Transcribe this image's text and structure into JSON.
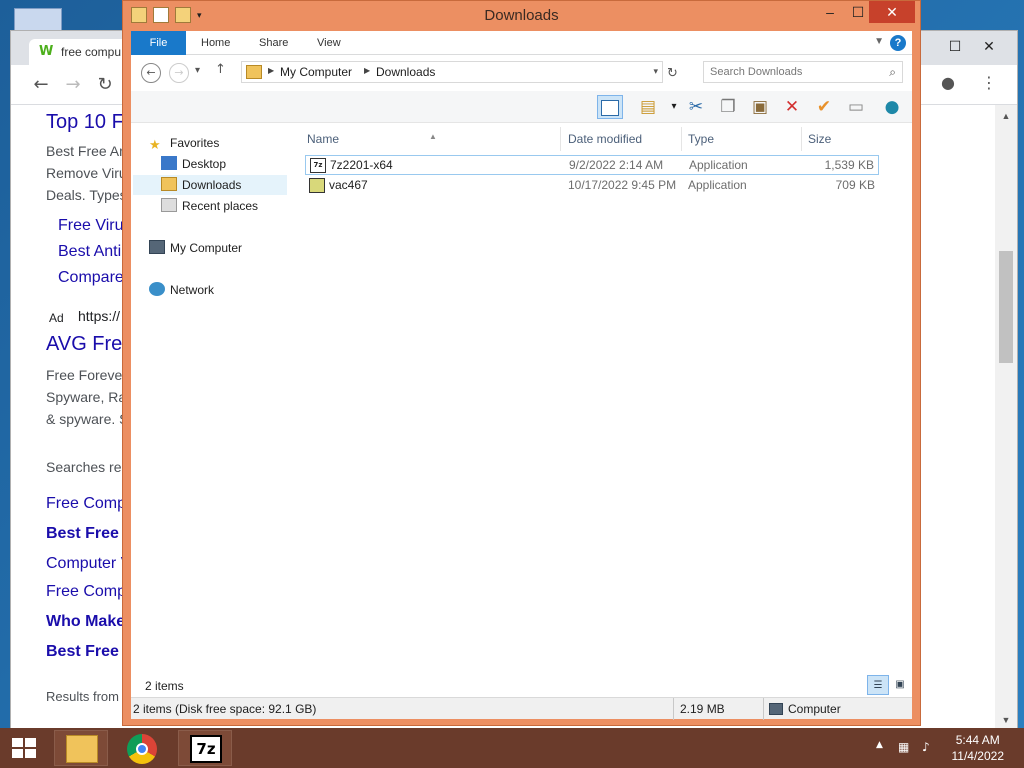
{
  "browser": {
    "tab_title": "free compu",
    "tab_icon_letter": "W",
    "results": {
      "title1": "Top 10 F",
      "text1": "Best Free An",
      "text2": "Remove Viru",
      "text3": "Deals. Types",
      "sub_links": [
        "Free Virus",
        "Best Anti",
        "Compare"
      ],
      "ad_label": "Ad",
      "ad_url": "https://",
      "title2": "AVG Free",
      "text4": "Free Forever",
      "text5": "Spyware, Ra",
      "text6": "& spyware. S",
      "searches_related": "Searches rel",
      "related": [
        "Free Comp",
        "Best Free A",
        "Computer V",
        "Free Comp",
        "Who Makes",
        "Best Free V"
      ],
      "results_from": "Results from"
    }
  },
  "explorer": {
    "window_title": "Downloads",
    "ribbon_tabs": [
      "File",
      "Home",
      "Share",
      "View"
    ],
    "breadcrumb": [
      "My Computer",
      "Downloads"
    ],
    "search_placeholder": "Search Downloads",
    "nav": {
      "favorites": "Favorites",
      "desktop": "Desktop",
      "downloads": "Downloads",
      "recent_places": "Recent places",
      "my_computer": "My Computer",
      "network": "Network"
    },
    "columns": {
      "name": "Name",
      "date_modified": "Date modified",
      "type": "Type",
      "size": "Size"
    },
    "files": [
      {
        "name": "7z2201-x64",
        "date": "9/2/2022 2:14 AM",
        "type": "Application",
        "size": "1,539 KB",
        "icon_label": "7z"
      },
      {
        "name": "vac467",
        "date": "10/17/2022 9:45 PM",
        "type": "Application",
        "size": "709 KB",
        "icon_label": ""
      }
    ],
    "item_count": "2 items",
    "statusbar": {
      "summary": "2 items (Disk free space: 92.1 GB)",
      "size": "2.19 MB",
      "location": "Computer"
    }
  },
  "taskbar": {
    "clock_time": "5:44 AM",
    "clock_date": "11/4/2022",
    "sevenzip_label": "7z"
  },
  "colors": {
    "explorer_frame": "#ec8f62",
    "file_tab": "#1979ca",
    "taskbar": "#6a3b2b",
    "link": "#1a0dab"
  }
}
